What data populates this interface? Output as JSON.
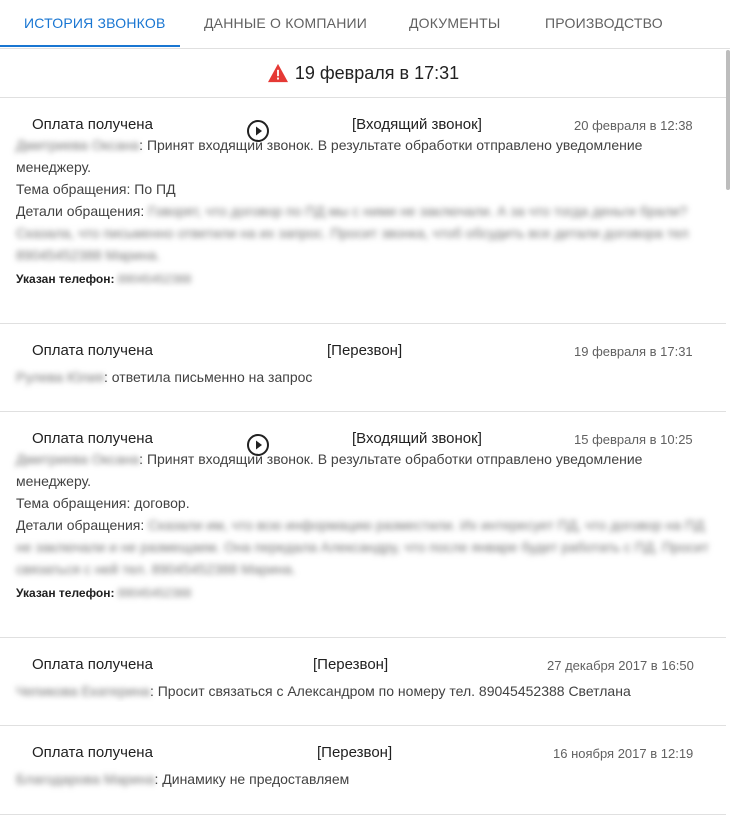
{
  "tabs": [
    {
      "label": "ИСТОРИЯ ЗВОНКОВ",
      "active": true
    },
    {
      "label": "ДАННЫЕ О КОМПАНИИ",
      "active": false
    },
    {
      "label": "ДОКУМЕНТЫ",
      "active": false
    },
    {
      "label": "ПРОИЗВОДСТВО",
      "active": false
    }
  ],
  "date_header": {
    "text": "19 февраля в 17:31",
    "icon": "warning-icon"
  },
  "entries": [
    {
      "status": "Оплата получена",
      "type": "[Входящий звонок]",
      "date": "20 февраля в 12:38",
      "has_play": true,
      "author": "Дмитриева Оксана",
      "action": ": Принят входящий звонок. В результате обработки отправлено уведомление менеджеру.",
      "topic_label": "Тема обращения: ",
      "topic_value": "По ПД",
      "details_label": "Детали обращения: ",
      "details_value": "Говорят, что договор по ПД мы с ними не заключали. А за что тогда деньги брали? Сказала, что письменно ответили на их запрос. Просит звонка, чтоб обсудить все детали договора тел 89045452388 Марина.",
      "phone_label": "Указан телефон: ",
      "phone_value": "89045452388"
    },
    {
      "status": "Оплата получена",
      "type": "[Перезвон]",
      "date": "19 февраля в 17:31",
      "has_play": false,
      "author": "Рулева Юлия",
      "action": ": ответила письменно на запрос"
    },
    {
      "status": "Оплата получена",
      "type": "[Входящий звонок]",
      "date": "15 февраля в 10:25",
      "has_play": true,
      "author": "Дмитриева Оксана",
      "action": ": Принят входящий звонок. В результате обработки отправлено уведомление менеджеру.",
      "topic_label": "Тема обращения: ",
      "topic_value": "договор.",
      "details_label": "Детали обращения: ",
      "details_value": "Сказали им, что всю информацию разместили. Их интересует ПД, что договор на ПД не заключали и не размещаем. Она передала Александру, что после январе будет работать с ПД. Просит связаться с ней тел. 89045452388 Марина.",
      "phone_label": "Указан телефон: ",
      "phone_value": "89045452388"
    },
    {
      "status": "Оплата получена",
      "type": "[Перезвон]",
      "date": "27 декабря 2017 в 16:50",
      "has_play": false,
      "author": "Чепикова Екатерина",
      "action": ": Просит связаться с Александром по номеру тел. 89045452388 Светлана"
    },
    {
      "status": "Оплата получена",
      "type": "[Перезвон]",
      "date": "16 ноября 2017 в 12:19",
      "has_play": false,
      "author": "Благодарова Марина",
      "action": ": Динамику не предоставляем"
    }
  ]
}
